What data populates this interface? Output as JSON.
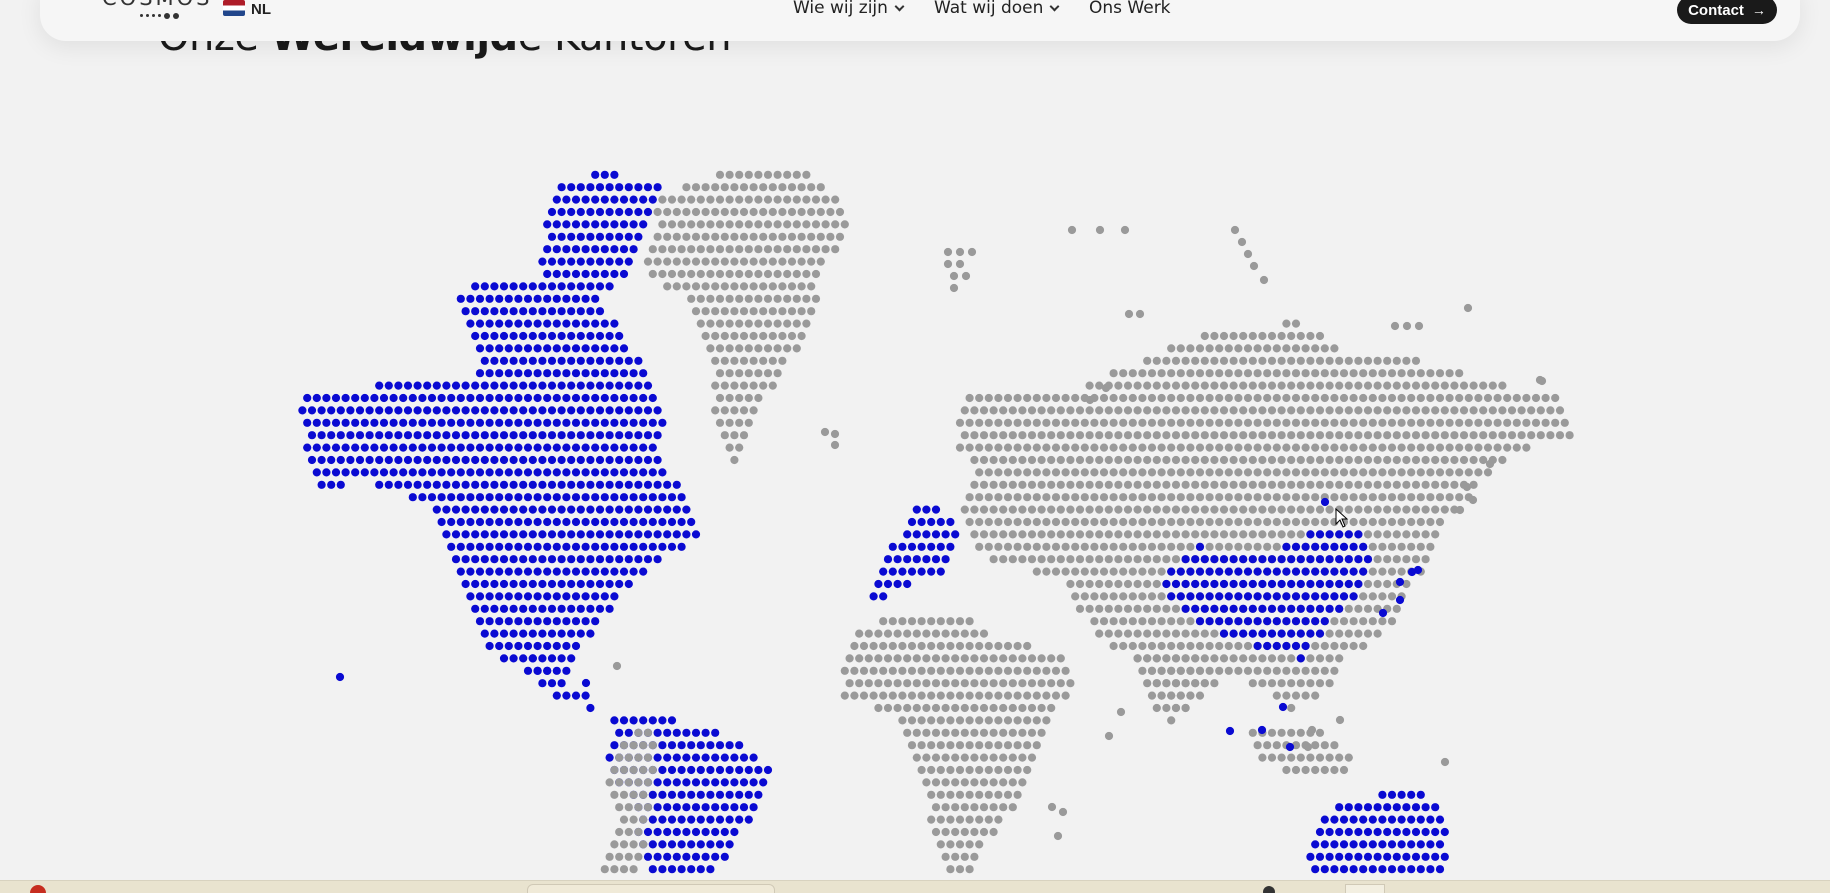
{
  "colors": {
    "highlight": "#0a0ad2",
    "land": "#9a9a9a",
    "background": "#f2f2f2",
    "brand_button": "#1a1a1a"
  },
  "header": {
    "logo_text": "COSMOS",
    "language": "NL",
    "nav": [
      {
        "label": "Wie wij zijn",
        "has_dropdown": true
      },
      {
        "label": "Wat wij doen",
        "has_dropdown": true
      },
      {
        "label": "Ons Werk",
        "has_dropdown": false
      }
    ],
    "contact_label": "Contact"
  },
  "section": {
    "title_prefix": "Onze ",
    "title_bold": "Wereldwijd",
    "title_suffix": "e Kantoren"
  },
  "icons": [
    "flag-nl-icon",
    "chevron-down-icon",
    "arrow-right-icon",
    "mouse-cursor-icon"
  ]
}
